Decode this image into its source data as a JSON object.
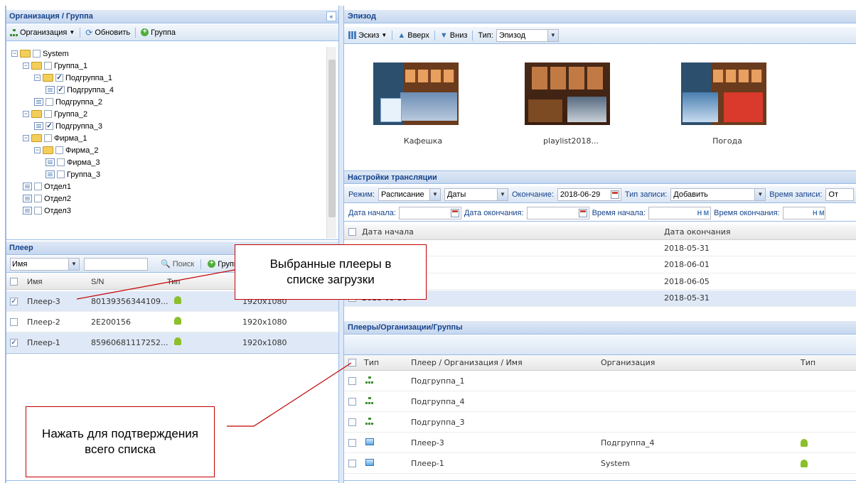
{
  "left": {
    "title": "Организация / Группа",
    "toolbar": {
      "org": "Организация",
      "refresh": "Обновить",
      "group": "Группа"
    },
    "tree": [
      {
        "label": "System",
        "checked": false,
        "icon": "folder",
        "toggle": "-"
      },
      {
        "label": "Группа_1",
        "checked": false,
        "icon": "folder",
        "toggle": "-"
      },
      {
        "label": "Подгруппа_1",
        "checked": true,
        "icon": "folder",
        "toggle": "-"
      },
      {
        "label": "Подгруппа_4",
        "checked": true,
        "icon": "leaf",
        "toggle": ""
      },
      {
        "label": "Подгруппа_2",
        "checked": false,
        "icon": "leaf",
        "toggle": ""
      },
      {
        "label": "Группа_2",
        "checked": false,
        "icon": "folder",
        "toggle": "-"
      },
      {
        "label": "Подгруппа_3",
        "checked": true,
        "icon": "leaf",
        "toggle": ""
      },
      {
        "label": "Фирма_1",
        "checked": false,
        "icon": "folder",
        "toggle": "-"
      },
      {
        "label": "Фирма_2",
        "checked": false,
        "icon": "folder",
        "toggle": "-"
      },
      {
        "label": "Фирма_3",
        "checked": false,
        "icon": "leaf",
        "toggle": ""
      },
      {
        "label": "Группа_3",
        "checked": false,
        "icon": "leaf",
        "toggle": ""
      },
      {
        "label": "Отдел1",
        "checked": false,
        "icon": "leaf",
        "toggle": ""
      },
      {
        "label": "Отдел2",
        "checked": false,
        "icon": "leaf",
        "toggle": ""
      },
      {
        "label": "Отдел3",
        "checked": false,
        "icon": "leaf",
        "toggle": ""
      }
    ]
  },
  "player": {
    "title": "Плеер",
    "filter_value": "Имя",
    "search": "Поиск",
    "group": "Группа",
    "columns": [
      "Имя",
      "S/N",
      "Тип",
      ""
    ],
    "rows": [
      {
        "name": "Плеер-3",
        "sn": "80139356344109...",
        "res": "1920x1080",
        "checked": true
      },
      {
        "name": "Плеер-2",
        "sn": "2E200156",
        "res": "1920x1080",
        "checked": false
      },
      {
        "name": "Плеер-1",
        "sn": "85960681117252...",
        "res": "1920x1080",
        "checked": true
      }
    ]
  },
  "episode": {
    "title": "Эпизод",
    "toolbar": {
      "sketch": "Эскиз",
      "up": "Вверх",
      "down": "Вниз",
      "type_label": "Тип:",
      "type_value": "Эпизод"
    },
    "thumbs": [
      "Кафешка",
      "playlist2018...",
      "Погода"
    ]
  },
  "broadcast": {
    "title": "Настройки трансляции",
    "mode_label": "Режим:",
    "mode_value": "Расписание",
    "dates_value": "Даты",
    "end_label": "Окончание:",
    "end_value": "2018-06-29",
    "rec_type_label": "Тип записи:",
    "rec_type_value": "Добавить",
    "rec_time_label": "Время записи:",
    "rec_time_value": "От",
    "start_date_label": "Дата начала:",
    "end_date_label": "Дата окончания:",
    "start_time_label": "Время начала:",
    "end_time_label": "Время окончания:",
    "hm": "H M",
    "columns": [
      "Дата начала",
      "Дата окончания"
    ],
    "rows": [
      {
        "start": "",
        "end": "2018-05-31",
        "checked": false
      },
      {
        "start": "",
        "end": "2018-06-01",
        "checked": false
      },
      {
        "start": "",
        "end": "2018-06-05",
        "checked": false
      },
      {
        "start": "2018-05-30",
        "end": "2018-05-31",
        "checked": true
      }
    ]
  },
  "targets": {
    "title": "Плееры/Организации/Группы",
    "columns": [
      "Тип",
      "Плеер / Организация / Имя",
      "Организация",
      "Тип"
    ],
    "rows": [
      {
        "kind": "org",
        "name": "Подгруппа_1",
        "org": "",
        "android": false
      },
      {
        "kind": "org",
        "name": "Подгруппа_4",
        "org": "",
        "android": false
      },
      {
        "kind": "org",
        "name": "Подгруппа_3",
        "org": "",
        "android": false
      },
      {
        "kind": "player",
        "name": "Плеер-3",
        "org": "Подгруппа_4",
        "android": true
      },
      {
        "kind": "player",
        "name": "Плеер-1",
        "org": "System",
        "android": true
      }
    ]
  },
  "callouts": {
    "selected": "Выбранные плееры в списке загрузки",
    "confirm": "Нажать для подтверждения всего списка"
  },
  "colors": {
    "header_text": "#15428b",
    "border": "#99bbe8",
    "callout_border": "#c00000",
    "selected_row": "#dfe8f6",
    "android": "#8bbf2b"
  }
}
